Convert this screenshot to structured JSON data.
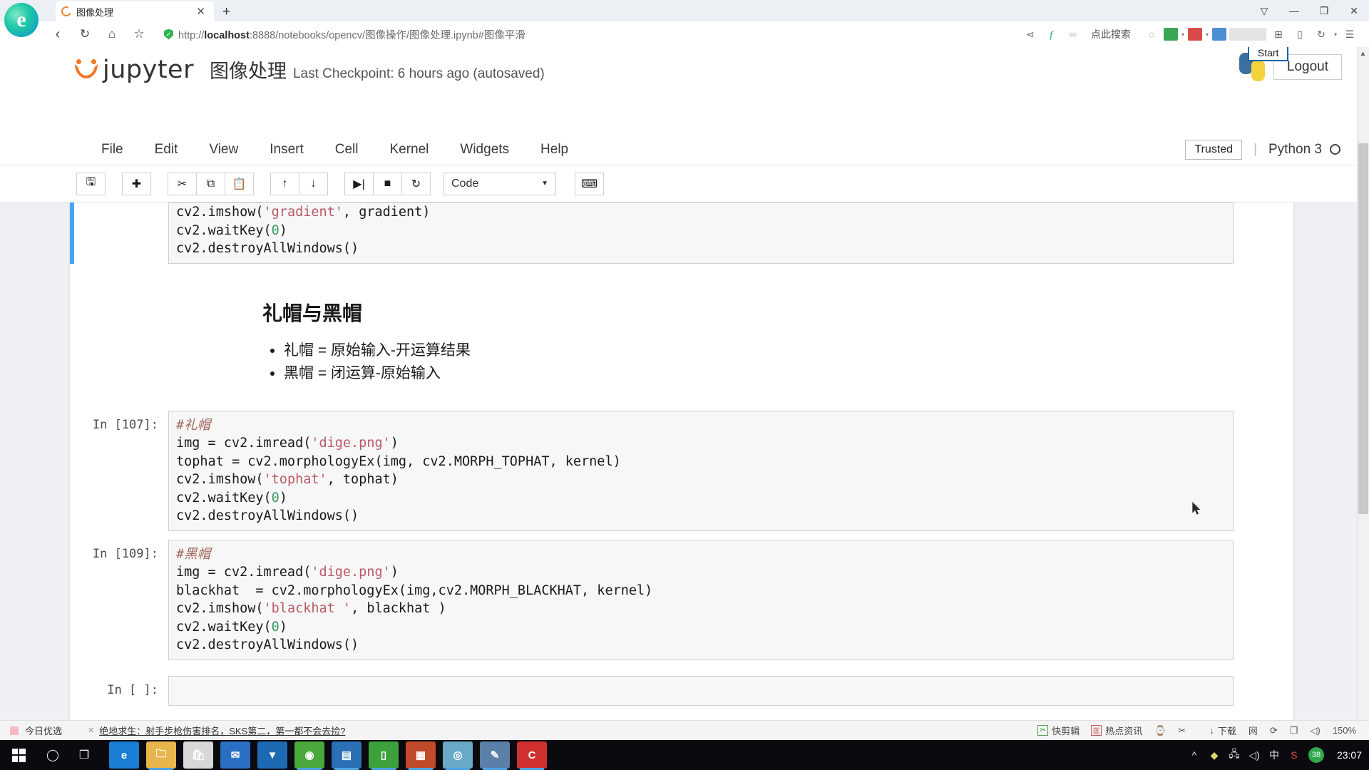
{
  "browser": {
    "tab": {
      "title": "图像处理",
      "favicon": "jupyter-spinner-icon",
      "close_label": "✕",
      "new_tab_label": "+"
    },
    "window_controls": [
      {
        "name": "collections-icon",
        "glyph": "▽"
      },
      {
        "name": "minimize-icon",
        "glyph": "—"
      },
      {
        "name": "maximize-icon",
        "glyph": "❐"
      },
      {
        "name": "close-icon",
        "glyph": "✕"
      }
    ],
    "nav": {
      "back": "‹",
      "refresh": "↻",
      "home": "⌂",
      "favorite": "☆"
    },
    "address": {
      "scheme": "http://",
      "host": "localhost",
      "rest": ":8888/notebooks/opencv/图像操作/图像处理.ipynb#图像平滑",
      "full": "http://localhost:8888/notebooks/opencv/图像操作/图像处理.ipynb#图像平滑"
    },
    "right_tools": {
      "share": "⋖",
      "search_hint": "点此搜索",
      "reader": "◌",
      "collections": "⊞",
      "devices": "▯",
      "history": "↻",
      "menu": "☰"
    }
  },
  "jupyter": {
    "brand": "jupyter",
    "notebook_name": "图像处理",
    "checkpoint": "Last Checkpoint: 6 hours ago (autosaved)",
    "start_tooltip": "Start",
    "logout_label": "Logout",
    "menus": [
      "File",
      "Edit",
      "View",
      "Insert",
      "Cell",
      "Kernel",
      "Widgets",
      "Help"
    ],
    "trusted_label": "Trusted",
    "kernel_label": "Python 3",
    "toolbar": {
      "buttons": [
        {
          "name": "save-button",
          "glyph": "🖫",
          "title": "Save"
        },
        {
          "name": "insert-cell-button",
          "glyph": "✚",
          "title": "Insert cell below"
        },
        {
          "name": "cut-button",
          "glyph": "✂",
          "title": "Cut"
        },
        {
          "name": "copy-button",
          "glyph": "⧉",
          "title": "Copy"
        },
        {
          "name": "paste-button",
          "glyph": "📋",
          "title": "Paste"
        },
        {
          "name": "move-up-button",
          "glyph": "↑",
          "title": "Move up"
        },
        {
          "name": "move-down-button",
          "glyph": "↓",
          "title": "Move down"
        },
        {
          "name": "run-button",
          "glyph": "▶|",
          "title": "Run"
        },
        {
          "name": "stop-button",
          "glyph": "■",
          "title": "Interrupt"
        },
        {
          "name": "restart-button",
          "glyph": "↻",
          "title": "Restart"
        }
      ],
      "cell_type": "Code",
      "cell_type_caret": "▼",
      "keyboard_button": "⌨"
    }
  },
  "notebook": {
    "partial_cell": {
      "lines": [
        [
          {
            "t": "cv2.imshow(",
            "c": ""
          },
          {
            "t": "'gradient'",
            "c": "s-str"
          },
          {
            "t": ", gradient)",
            "c": ""
          }
        ],
        [
          {
            "t": "cv2.waitKey(",
            "c": ""
          },
          {
            "t": "0",
            "c": "s-num"
          },
          {
            "t": ")",
            "c": ""
          }
        ],
        [
          {
            "t": "cv2.destroyAllWindows()",
            "c": ""
          }
        ]
      ]
    },
    "markdown": {
      "heading": "礼帽与黑帽",
      "bullets": [
        "礼帽 = 原始输入-开运算结果",
        "黑帽 = 闭运算-原始输入"
      ]
    },
    "cells": [
      {
        "prompt": "In [107]:",
        "lines": [
          [
            {
              "t": "#礼帽",
              "c": "s-com"
            }
          ],
          [
            {
              "t": "img = cv2.imread(",
              "c": ""
            },
            {
              "t": "'dige.png'",
              "c": "s-str"
            },
            {
              "t": ")",
              "c": ""
            }
          ],
          [
            {
              "t": "tophat = cv2.morphologyEx(img, cv2.MORPH_TOPHAT, kernel)",
              "c": ""
            }
          ],
          [
            {
              "t": "cv2.imshow(",
              "c": ""
            },
            {
              "t": "'tophat'",
              "c": "s-str"
            },
            {
              "t": ", tophat)",
              "c": ""
            }
          ],
          [
            {
              "t": "cv2.waitKey(",
              "c": ""
            },
            {
              "t": "0",
              "c": "s-num"
            },
            {
              "t": ")",
              "c": ""
            }
          ],
          [
            {
              "t": "cv2.destroyAllWindows()",
              "c": ""
            }
          ]
        ]
      },
      {
        "prompt": "In [109]:",
        "lines": [
          [
            {
              "t": "#黑帽",
              "c": "s-com"
            }
          ],
          [
            {
              "t": "img = cv2.imread(",
              "c": ""
            },
            {
              "t": "'dige.png'",
              "c": "s-str"
            },
            {
              "t": ")",
              "c": ""
            }
          ],
          [
            {
              "t": "blackhat  = cv2.morphologyEx(img,cv2.MORPH_BLACKHAT, kernel)",
              "c": ""
            }
          ],
          [
            {
              "t": "cv2.imshow(",
              "c": ""
            },
            {
              "t": "'blackhat '",
              "c": "s-str"
            },
            {
              "t": ", blackhat )",
              "c": ""
            }
          ],
          [
            {
              "t": "cv2.waitKey(",
              "c": ""
            },
            {
              "t": "0",
              "c": "s-num"
            },
            {
              "t": ")",
              "c": ""
            }
          ],
          [
            {
              "t": "cv2.destroyAllWindows()",
              "c": ""
            }
          ]
        ]
      },
      {
        "prompt": "In [ ]:",
        "lines": []
      }
    ]
  },
  "news_bar": {
    "label": "今日优选",
    "close_glyph": "✕",
    "headline": "绝地求生：射手步枪伤害排名，SKS第二，第一都不会去捡?",
    "tools": [
      {
        "name": "clip-tool",
        "chip": "✂",
        "label": "快剪辑"
      },
      {
        "name": "hot-news-tool",
        "chip": "匡",
        "label": "热点资讯"
      }
    ],
    "icons": [
      "⌚",
      "✂",
      "↓"
    ],
    "download_label": "下载",
    "more_icons": [
      "网",
      "⟳",
      "❐",
      "◁)"
    ],
    "zoom_level": "150%"
  },
  "taskbar": {
    "start_name": "windows-start-button",
    "system_icons": [
      {
        "name": "cortana-search-icon",
        "glyph": "◯"
      },
      {
        "name": "task-view-icon",
        "glyph": "❐"
      }
    ],
    "apps": [
      {
        "name": "edge-taskbar-icon",
        "glyph": "e",
        "color": "#1a7fd4",
        "active": false
      },
      {
        "name": "file-explorer-taskbar-icon",
        "glyph": "🗀",
        "color": "#e8b54c",
        "active": true
      },
      {
        "name": "store-taskbar-icon",
        "glyph": "🛍",
        "color": "#d8d8d8",
        "active": false
      },
      {
        "name": "mail-taskbar-icon",
        "glyph": "✉",
        "color": "#2a6fc4",
        "active": false
      },
      {
        "name": "foxmail-taskbar-icon",
        "glyph": "▼",
        "color": "#1d69b4",
        "active": false
      },
      {
        "name": "browser-taskbar-icon",
        "glyph": "◉",
        "color": "#4aa83c",
        "active": true
      },
      {
        "name": "office-taskbar-icon",
        "glyph": "▤",
        "color": "#2b6fb5",
        "active": true
      },
      {
        "name": "notepad-taskbar-icon",
        "glyph": "▯",
        "color": "#3da23d",
        "active": true
      },
      {
        "name": "archive-taskbar-icon",
        "glyph": "▦",
        "color": "#c04a2a",
        "active": true
      },
      {
        "name": "recorder-taskbar-icon",
        "glyph": "◎",
        "color": "#6aa8c8",
        "active": true
      },
      {
        "name": "snip-taskbar-icon",
        "glyph": "✎",
        "color": "#5a7fa8",
        "active": true
      },
      {
        "name": "pycharm-taskbar-icon",
        "glyph": "C",
        "color": "#d03030",
        "active": true
      }
    ],
    "tray": [
      {
        "name": "show-hidden-icons",
        "glyph": "^"
      },
      {
        "name": "security-icon",
        "glyph": "◆"
      },
      {
        "name": "network-icon",
        "glyph": "🖧"
      },
      {
        "name": "volume-icon",
        "glyph": "◁)"
      },
      {
        "name": "ime-icon",
        "glyph": "中"
      },
      {
        "name": "sogou-icon",
        "glyph": "S"
      }
    ],
    "battery_badge": "38",
    "clock": "23:07"
  }
}
